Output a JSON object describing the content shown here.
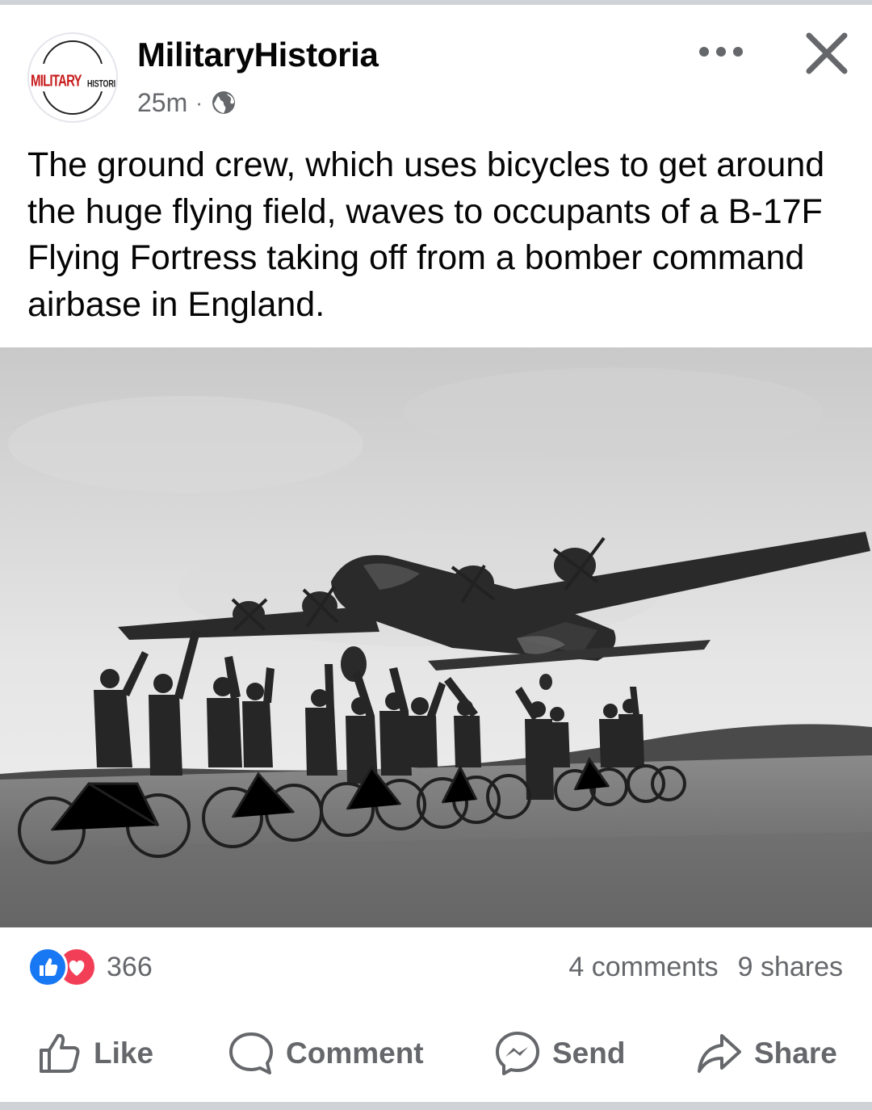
{
  "post": {
    "author": {
      "name": "MilitaryHistoria",
      "avatar_logo_main": "MILITARY",
      "avatar_logo_sub": "HISTORIA"
    },
    "timestamp": "25m",
    "separator": "·",
    "privacy_icon": "globe-icon",
    "caption": "The ground crew, which uses bicycles to get around the huge flying field, waves to occupants of a B-17F Flying Fortress taking off from a bomber command airbase in England.",
    "photo_icon": "photo-b17-ground-crew-bicycles"
  },
  "engagement": {
    "reaction_icons": [
      "like-reaction-icon",
      "love-reaction-icon"
    ],
    "reaction_count": "366",
    "comments": "4 comments",
    "shares": "9 shares"
  },
  "actions": {
    "like": "Like",
    "comment": "Comment",
    "send": "Send",
    "share": "Share"
  },
  "colors": {
    "brand_blue": "#1877f2",
    "love_red": "#f33e58",
    "secondary_text": "#65676b",
    "logo_red": "#c81e1e"
  }
}
